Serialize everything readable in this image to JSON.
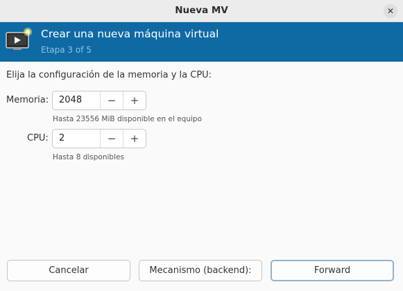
{
  "window": {
    "title": "Nueva MV"
  },
  "banner": {
    "heading": "Crear una nueva máquina virtual",
    "step": "Etapa 3 of 5"
  },
  "instructions": "Elija la configuración de la memoria y la CPU:",
  "memory": {
    "label": "Memoria:",
    "value": "2048",
    "decrement": "−",
    "increment": "+",
    "hint": "Hasta 23556 MiB disponible en el equipo"
  },
  "cpu": {
    "label": "CPU:",
    "value": "2",
    "decrement": "−",
    "increment": "+",
    "hint": "Hasta 8 disponibles"
  },
  "footer": {
    "cancel": "Cancelar",
    "backend": "Mecanismo (backend):",
    "forward": "Forward"
  },
  "icons": {
    "close": "close-icon",
    "wizard": "new-vm-icon"
  },
  "colors": {
    "banner_bg": "#0f6aa4",
    "banner_subtitle": "#8ec4e6",
    "primary_border": "#8fb4d0"
  }
}
